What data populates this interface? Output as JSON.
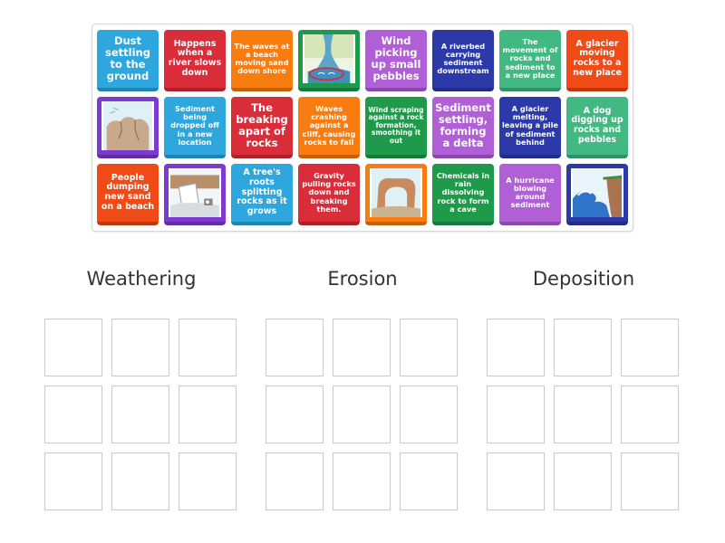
{
  "colors": {
    "blue": "#2ea7df",
    "red": "#d92d3a",
    "orange": "#f97c10",
    "green": "#1f9a4b",
    "purple": "#b05fd6",
    "navy": "#2b3aa8",
    "mint": "#42b882",
    "violet": "#7d3ad0"
  },
  "cards": {
    "c1": "Dust settling to the ground",
    "c2": "Happens when a river slows down",
    "c3": "The waves at a beach moving sand down shore",
    "c4": "",
    "c5": "Wind picking up small pebbles",
    "c6": "A riverbed carrying sediment downstream",
    "c7": "The movement of rocks and sediment to a new place",
    "c8": "A glacier moving rocks to a new place",
    "c9": "",
    "c10": "Sediment being dropped off in a new location",
    "c11": "The breaking apart of rocks",
    "c12": "Waves crashing against a cliff, causing rocks to fall",
    "c13": "Wind scraping against a rock formation, smoothing it out",
    "c14": "Sediment settling, forming a delta",
    "c15": "A glacier melting, leaving a pile of sediment behind",
    "c16": "A dog digging up rocks and pebbles",
    "c17": "People dumping new sand on a beach",
    "c18": "",
    "c19": "A tree's roots splitting rocks as it grows",
    "c20": "Gravity pulling rocks down and breaking them.",
    "c21": "",
    "c22": "Chemicals in rain dissolving rock to form a cave",
    "c23": "A hurricane blowing around sediment",
    "c24": ""
  },
  "image_cards": {
    "c4": "river-delta-image",
    "c9": "weathered-rock-image",
    "c18": "ice-boulder-image",
    "c21": "rock-arch-image",
    "c24": "ocean-wave-cliff-image"
  },
  "categories": {
    "weathering": "Weathering",
    "erosion": "Erosion",
    "deposition": "Deposition"
  }
}
